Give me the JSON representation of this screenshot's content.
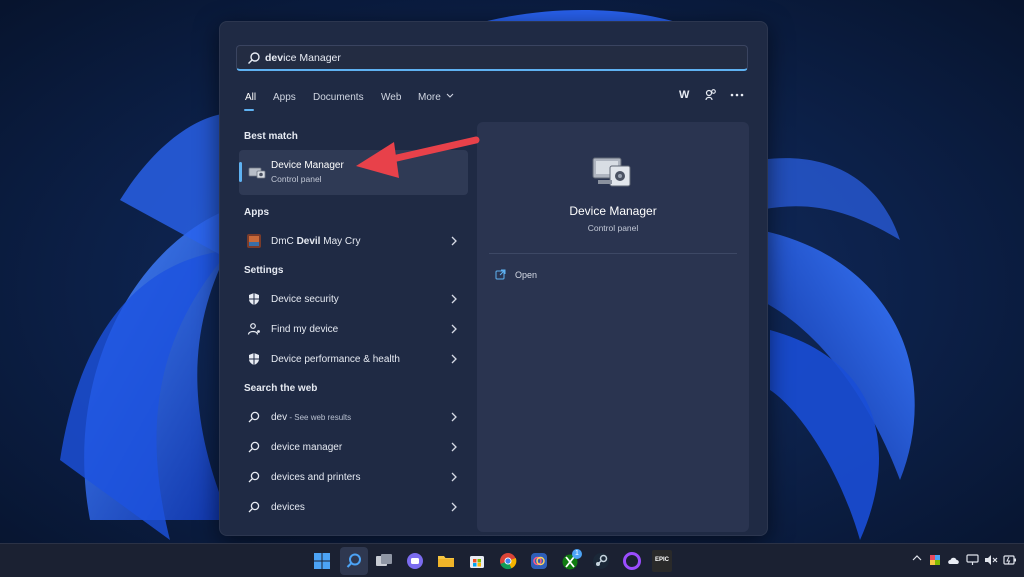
{
  "search": {
    "query_bold": "dev",
    "query_rest": "ice Manager"
  },
  "filters": {
    "tabs": [
      {
        "label": "All",
        "active": true
      },
      {
        "label": "Apps",
        "active": false
      },
      {
        "label": "Documents",
        "active": false
      },
      {
        "label": "Web",
        "active": false
      },
      {
        "label": "More",
        "active": false
      }
    ],
    "account_label": "W"
  },
  "best_match": {
    "header": "Best match",
    "title": "Device Manager",
    "subtitle": "Control panel",
    "icon": "device-manager-icon"
  },
  "apps": {
    "header": "Apps",
    "items": [
      {
        "label_pre": "DmC ",
        "label_bold": "Devil",
        "label_post": " May Cry",
        "icon": "dmc-game-icon"
      }
    ]
  },
  "settings": {
    "header": "Settings",
    "items": [
      {
        "label": "Device security",
        "icon": "shield-icon"
      },
      {
        "label": "Find my device",
        "icon": "person-location-icon"
      },
      {
        "label": "Device performance & health",
        "icon": "shield-icon"
      }
    ]
  },
  "web": {
    "header": "Search the web",
    "items": [
      {
        "label": "dev",
        "suffix": " - See web results",
        "icon": "search-icon"
      },
      {
        "label": "device manager",
        "suffix": "",
        "icon": "search-icon"
      },
      {
        "label": "devices and printers",
        "suffix": "",
        "icon": "search-icon"
      },
      {
        "label": "devices",
        "suffix": "",
        "icon": "search-icon"
      }
    ]
  },
  "detail": {
    "title": "Device Manager",
    "subtitle": "Control panel",
    "action_open": "Open"
  },
  "taskbar": {
    "steam_badge": "1",
    "epic_label": "EPIC"
  },
  "colors": {
    "accent": "#5fb2f2",
    "annotation_arrow": "#e8414a"
  }
}
